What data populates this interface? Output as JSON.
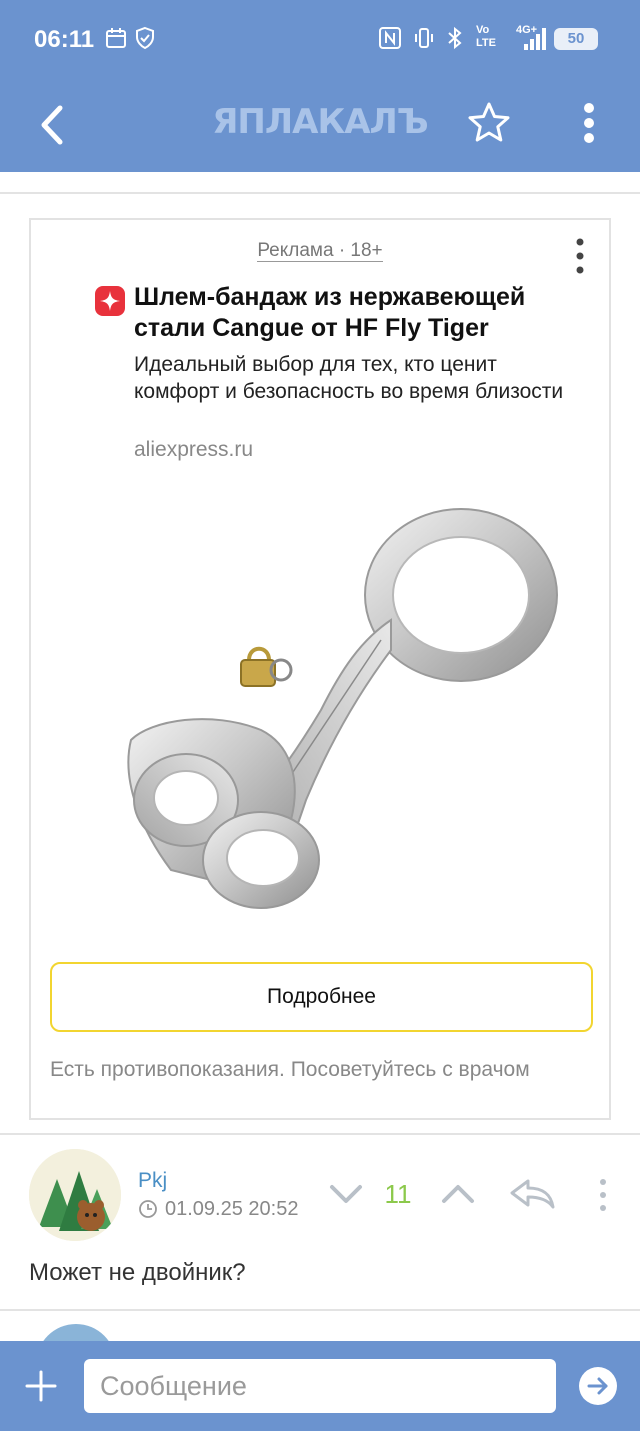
{
  "status_bar": {
    "time": "06:11",
    "network_label_1": "Vo",
    "network_label_2": "LTE",
    "signal_label": "4G+",
    "battery": "50"
  },
  "app_bar": {
    "logo": "ЯПЛАКАЛЪ",
    "back_icon": "chevron-left-icon",
    "favorite_icon": "star-outline-icon",
    "menu_icon": "more-vertical-icon"
  },
  "ad": {
    "label": "Реклама · 18+",
    "title": "Шлем-бандаж из нержавеющей стали Cangue от HF Fly Tiger",
    "description": "Идеальный выбор для тех, кто ценит комфорт и безопасность во время близости",
    "domain": "aliexpress.ru",
    "cta": "Подробнее",
    "disclaimer": "Есть противопоказания. Посоветуйтесь с врачом",
    "cta_border_color": "#f2d530",
    "brand_color": "#e8323c"
  },
  "comment": {
    "author": "Pkj",
    "date": "01.09.25 20:52",
    "score": "11",
    "text": "Может не двойник?",
    "author_color": "#4a8fc5",
    "score_color": "#8cc94b"
  },
  "composer": {
    "placeholder": "Сообщение",
    "add_icon": "plus-icon",
    "send_icon": "send-arrow-icon"
  },
  "theme": {
    "primary": "#6b93cf"
  }
}
